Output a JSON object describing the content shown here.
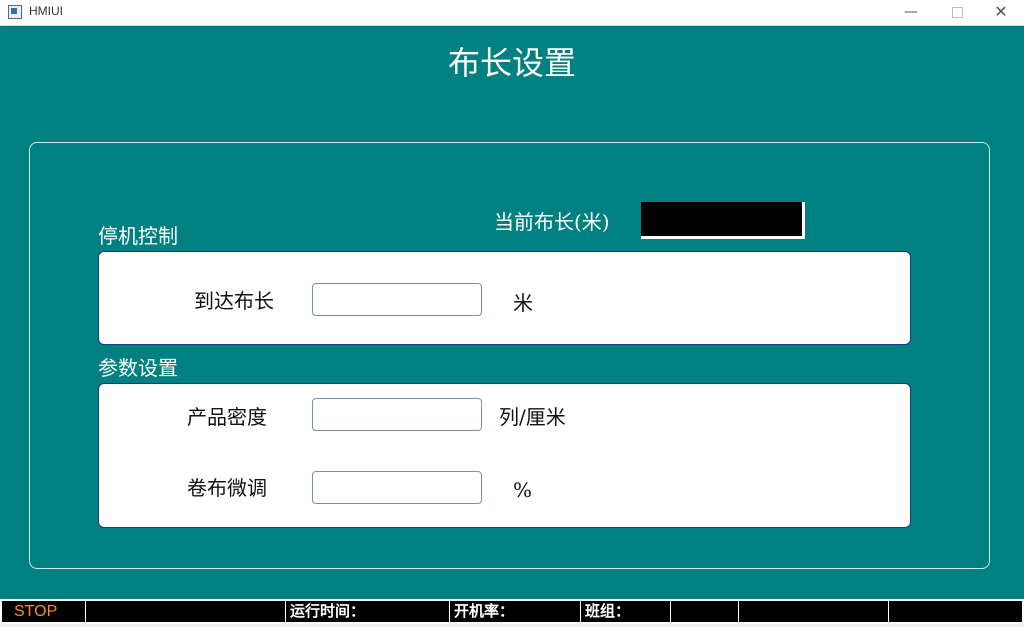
{
  "window": {
    "title": "HMIUI",
    "minimize_glyph": "—",
    "close_glyph": "✕"
  },
  "page": {
    "title": "布长设置"
  },
  "current_length": {
    "label": "当前布长(米)",
    "value": ""
  },
  "stop_control": {
    "section_label": "停机控制",
    "target_length": {
      "label": "到达布长",
      "value": "",
      "unit": "米"
    }
  },
  "parameters": {
    "section_label": "参数设置",
    "density": {
      "label": "产品密度",
      "value": "",
      "unit": "列/厘米"
    },
    "fine_tune": {
      "label": "卷布微调",
      "value": "",
      "unit": "%"
    }
  },
  "statusbar": {
    "state": "STOP",
    "state_color": "#ff8c1a",
    "blank_1": "",
    "run_time_label": "运行时间：",
    "uptime_label": "开机率：",
    "shift_label": "班组：",
    "blank_2": "",
    "blank_3": "",
    "blank_4": "",
    "blank_5": ""
  },
  "colors": {
    "background": "#008080",
    "panel": "#ffffff",
    "value_box": "#000000"
  }
}
